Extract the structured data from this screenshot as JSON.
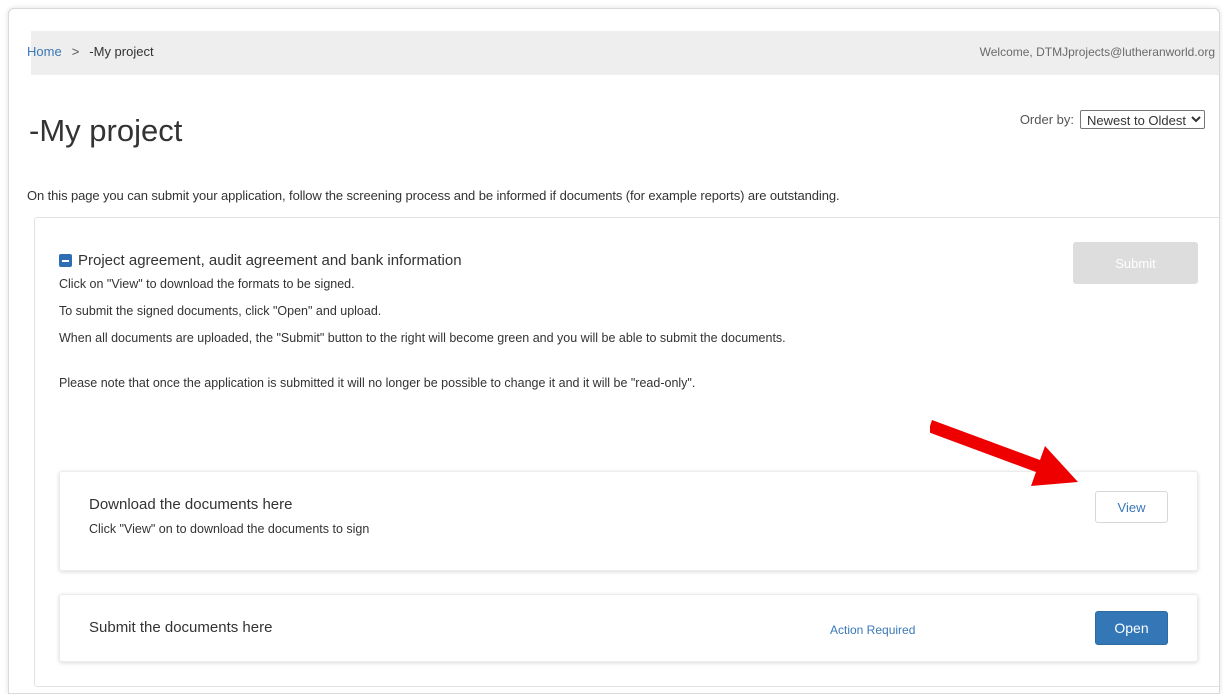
{
  "breadcrumb": {
    "home": "Home",
    "separator": ">",
    "current": "-My project"
  },
  "header": {
    "welcome": "Welcome, DTMJprojects@lutheranworld.org"
  },
  "page": {
    "title": "-My project",
    "order_by_label": "Order by:",
    "order_by_selected": "Newest to Oldest",
    "intro": "On this page you can submit your application, follow the screening process and be informed if documents (for example reports) are outstanding."
  },
  "section": {
    "title": "Project agreement, audit agreement and bank information",
    "submit_label": "Submit",
    "instructions": [
      "Click on \"View\" to download the formats to be signed.",
      "To submit the signed documents, click \"Open\" and upload.",
      "When all documents are uploaded, the \"Submit\" button to the right will become green and you will be able to submit the documents.",
      "Please note that once the application is submitted it will no longer be possible to change it and it will be \"read-only\"."
    ]
  },
  "download_card": {
    "title": "Download the documents here",
    "subtitle": "Click \"View\" on to download the documents to sign",
    "button_label": "View"
  },
  "submit_card": {
    "title": "Submit the documents here",
    "status": "Action Required",
    "button_label": "Open"
  },
  "colors": {
    "link_blue": "#3a78b8",
    "primary_button": "#3377b7",
    "disabled_button": "#dddddd",
    "annotation_arrow": "#ee0000"
  },
  "icons": {
    "collapse": "minus-square-icon",
    "annotation": "red-arrow-icon"
  }
}
